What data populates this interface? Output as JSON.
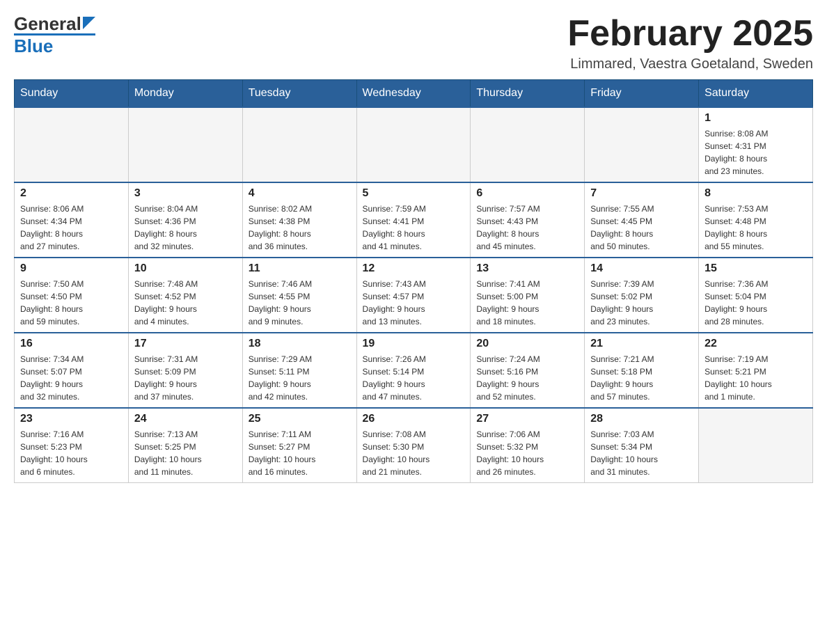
{
  "header": {
    "logo_top": "General",
    "logo_bottom": "Blue",
    "month_title": "February 2025",
    "location": "Limmared, Vaestra Goetaland, Sweden"
  },
  "weekdays": [
    "Sunday",
    "Monday",
    "Tuesday",
    "Wednesday",
    "Thursday",
    "Friday",
    "Saturday"
  ],
  "weeks": [
    [
      {
        "day": "",
        "info": ""
      },
      {
        "day": "",
        "info": ""
      },
      {
        "day": "",
        "info": ""
      },
      {
        "day": "",
        "info": ""
      },
      {
        "day": "",
        "info": ""
      },
      {
        "day": "",
        "info": ""
      },
      {
        "day": "1",
        "info": "Sunrise: 8:08 AM\nSunset: 4:31 PM\nDaylight: 8 hours\nand 23 minutes."
      }
    ],
    [
      {
        "day": "2",
        "info": "Sunrise: 8:06 AM\nSunset: 4:34 PM\nDaylight: 8 hours\nand 27 minutes."
      },
      {
        "day": "3",
        "info": "Sunrise: 8:04 AM\nSunset: 4:36 PM\nDaylight: 8 hours\nand 32 minutes."
      },
      {
        "day": "4",
        "info": "Sunrise: 8:02 AM\nSunset: 4:38 PM\nDaylight: 8 hours\nand 36 minutes."
      },
      {
        "day": "5",
        "info": "Sunrise: 7:59 AM\nSunset: 4:41 PM\nDaylight: 8 hours\nand 41 minutes."
      },
      {
        "day": "6",
        "info": "Sunrise: 7:57 AM\nSunset: 4:43 PM\nDaylight: 8 hours\nand 45 minutes."
      },
      {
        "day": "7",
        "info": "Sunrise: 7:55 AM\nSunset: 4:45 PM\nDaylight: 8 hours\nand 50 minutes."
      },
      {
        "day": "8",
        "info": "Sunrise: 7:53 AM\nSunset: 4:48 PM\nDaylight: 8 hours\nand 55 minutes."
      }
    ],
    [
      {
        "day": "9",
        "info": "Sunrise: 7:50 AM\nSunset: 4:50 PM\nDaylight: 8 hours\nand 59 minutes."
      },
      {
        "day": "10",
        "info": "Sunrise: 7:48 AM\nSunset: 4:52 PM\nDaylight: 9 hours\nand 4 minutes."
      },
      {
        "day": "11",
        "info": "Sunrise: 7:46 AM\nSunset: 4:55 PM\nDaylight: 9 hours\nand 9 minutes."
      },
      {
        "day": "12",
        "info": "Sunrise: 7:43 AM\nSunset: 4:57 PM\nDaylight: 9 hours\nand 13 minutes."
      },
      {
        "day": "13",
        "info": "Sunrise: 7:41 AM\nSunset: 5:00 PM\nDaylight: 9 hours\nand 18 minutes."
      },
      {
        "day": "14",
        "info": "Sunrise: 7:39 AM\nSunset: 5:02 PM\nDaylight: 9 hours\nand 23 minutes."
      },
      {
        "day": "15",
        "info": "Sunrise: 7:36 AM\nSunset: 5:04 PM\nDaylight: 9 hours\nand 28 minutes."
      }
    ],
    [
      {
        "day": "16",
        "info": "Sunrise: 7:34 AM\nSunset: 5:07 PM\nDaylight: 9 hours\nand 32 minutes."
      },
      {
        "day": "17",
        "info": "Sunrise: 7:31 AM\nSunset: 5:09 PM\nDaylight: 9 hours\nand 37 minutes."
      },
      {
        "day": "18",
        "info": "Sunrise: 7:29 AM\nSunset: 5:11 PM\nDaylight: 9 hours\nand 42 minutes."
      },
      {
        "day": "19",
        "info": "Sunrise: 7:26 AM\nSunset: 5:14 PM\nDaylight: 9 hours\nand 47 minutes."
      },
      {
        "day": "20",
        "info": "Sunrise: 7:24 AM\nSunset: 5:16 PM\nDaylight: 9 hours\nand 52 minutes."
      },
      {
        "day": "21",
        "info": "Sunrise: 7:21 AM\nSunset: 5:18 PM\nDaylight: 9 hours\nand 57 minutes."
      },
      {
        "day": "22",
        "info": "Sunrise: 7:19 AM\nSunset: 5:21 PM\nDaylight: 10 hours\nand 1 minute."
      }
    ],
    [
      {
        "day": "23",
        "info": "Sunrise: 7:16 AM\nSunset: 5:23 PM\nDaylight: 10 hours\nand 6 minutes."
      },
      {
        "day": "24",
        "info": "Sunrise: 7:13 AM\nSunset: 5:25 PM\nDaylight: 10 hours\nand 11 minutes."
      },
      {
        "day": "25",
        "info": "Sunrise: 7:11 AM\nSunset: 5:27 PM\nDaylight: 10 hours\nand 16 minutes."
      },
      {
        "day": "26",
        "info": "Sunrise: 7:08 AM\nSunset: 5:30 PM\nDaylight: 10 hours\nand 21 minutes."
      },
      {
        "day": "27",
        "info": "Sunrise: 7:06 AM\nSunset: 5:32 PM\nDaylight: 10 hours\nand 26 minutes."
      },
      {
        "day": "28",
        "info": "Sunrise: 7:03 AM\nSunset: 5:34 PM\nDaylight: 10 hours\nand 31 minutes."
      },
      {
        "day": "",
        "info": ""
      }
    ]
  ]
}
